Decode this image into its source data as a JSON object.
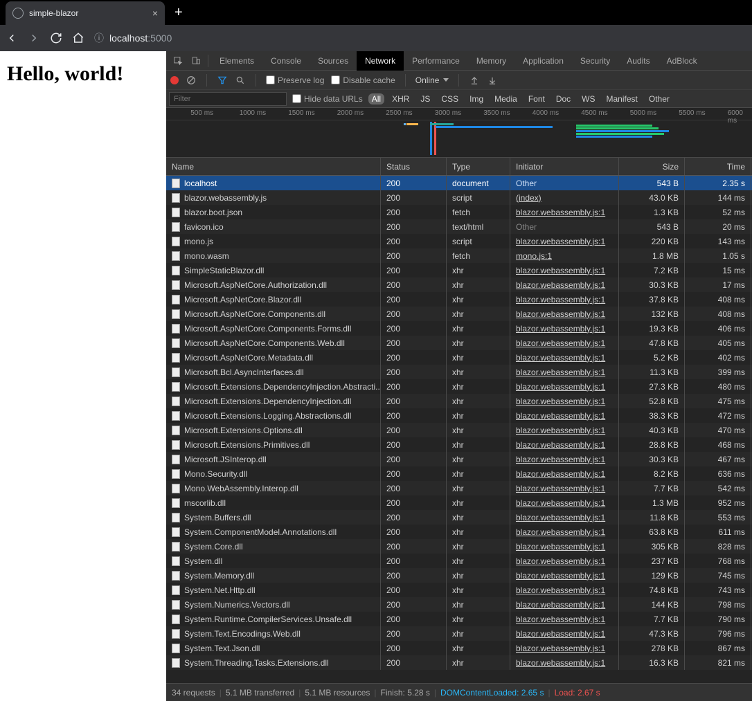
{
  "browser": {
    "tab_title": "simple-blazor",
    "url_info_icon": "ⓘ",
    "url_host": "localhost",
    "url_port": ":5000"
  },
  "page": {
    "heading": "Hello, world!"
  },
  "devtools": {
    "tabs": [
      "Elements",
      "Console",
      "Sources",
      "Network",
      "Performance",
      "Memory",
      "Application",
      "Security",
      "Audits",
      "AdBlock"
    ],
    "active_tab": "Network",
    "toolbar": {
      "preserve_log": "Preserve log",
      "disable_cache": "Disable cache",
      "online": "Online"
    },
    "filter": {
      "placeholder": "Filter",
      "hide_data_urls": "Hide data URLs",
      "chips": [
        "All",
        "XHR",
        "JS",
        "CSS",
        "Img",
        "Media",
        "Font",
        "Doc",
        "WS",
        "Manifest",
        "Other"
      ],
      "active_chip": "All"
    },
    "timeline_ticks": [
      "500 ms",
      "1000 ms",
      "1500 ms",
      "2000 ms",
      "2500 ms",
      "3000 ms",
      "3500 ms",
      "4000 ms",
      "4500 ms",
      "5000 ms",
      "5500 ms",
      "6000 ms"
    ],
    "columns": {
      "name": "Name",
      "status": "Status",
      "type": "Type",
      "initiator": "Initiator",
      "size": "Size",
      "time": "Time"
    },
    "rows": [
      {
        "name": "localhost",
        "status": "200",
        "type": "document",
        "initiator": "Other",
        "init_link": false,
        "size": "543 B",
        "time": "2.35 s",
        "selected": true
      },
      {
        "name": "blazor.webassembly.js",
        "status": "200",
        "type": "script",
        "initiator": "(index)",
        "init_link": true,
        "size": "43.0 KB",
        "time": "144 ms"
      },
      {
        "name": "blazor.boot.json",
        "status": "200",
        "type": "fetch",
        "initiator": "blazor.webassembly.js:1",
        "init_link": true,
        "size": "1.3 KB",
        "time": "52 ms"
      },
      {
        "name": "favicon.ico",
        "status": "200",
        "type": "text/html",
        "initiator": "Other",
        "init_link": false,
        "size": "543 B",
        "time": "20 ms"
      },
      {
        "name": "mono.js",
        "status": "200",
        "type": "script",
        "initiator": "blazor.webassembly.js:1",
        "init_link": true,
        "size": "220 KB",
        "time": "143 ms"
      },
      {
        "name": "mono.wasm",
        "status": "200",
        "type": "fetch",
        "initiator": "mono.js:1",
        "init_link": true,
        "size": "1.8 MB",
        "time": "1.05 s"
      },
      {
        "name": "SimpleStaticBlazor.dll",
        "status": "200",
        "type": "xhr",
        "initiator": "blazor.webassembly.js:1",
        "init_link": true,
        "size": "7.2 KB",
        "time": "15 ms"
      },
      {
        "name": "Microsoft.AspNetCore.Authorization.dll",
        "status": "200",
        "type": "xhr",
        "initiator": "blazor.webassembly.js:1",
        "init_link": true,
        "size": "30.3 KB",
        "time": "17 ms"
      },
      {
        "name": "Microsoft.AspNetCore.Blazor.dll",
        "status": "200",
        "type": "xhr",
        "initiator": "blazor.webassembly.js:1",
        "init_link": true,
        "size": "37.8 KB",
        "time": "408 ms"
      },
      {
        "name": "Microsoft.AspNetCore.Components.dll",
        "status": "200",
        "type": "xhr",
        "initiator": "blazor.webassembly.js:1",
        "init_link": true,
        "size": "132 KB",
        "time": "408 ms"
      },
      {
        "name": "Microsoft.AspNetCore.Components.Forms.dll",
        "status": "200",
        "type": "xhr",
        "initiator": "blazor.webassembly.js:1",
        "init_link": true,
        "size": "19.3 KB",
        "time": "406 ms"
      },
      {
        "name": "Microsoft.AspNetCore.Components.Web.dll",
        "status": "200",
        "type": "xhr",
        "initiator": "blazor.webassembly.js:1",
        "init_link": true,
        "size": "47.8 KB",
        "time": "405 ms"
      },
      {
        "name": "Microsoft.AspNetCore.Metadata.dll",
        "status": "200",
        "type": "xhr",
        "initiator": "blazor.webassembly.js:1",
        "init_link": true,
        "size": "5.2 KB",
        "time": "402 ms"
      },
      {
        "name": "Microsoft.Bcl.AsyncInterfaces.dll",
        "status": "200",
        "type": "xhr",
        "initiator": "blazor.webassembly.js:1",
        "init_link": true,
        "size": "11.3 KB",
        "time": "399 ms"
      },
      {
        "name": "Microsoft.Extensions.DependencyInjection.Abstracti...",
        "status": "200",
        "type": "xhr",
        "initiator": "blazor.webassembly.js:1",
        "init_link": true,
        "size": "27.3 KB",
        "time": "480 ms"
      },
      {
        "name": "Microsoft.Extensions.DependencyInjection.dll",
        "status": "200",
        "type": "xhr",
        "initiator": "blazor.webassembly.js:1",
        "init_link": true,
        "size": "52.8 KB",
        "time": "475 ms"
      },
      {
        "name": "Microsoft.Extensions.Logging.Abstractions.dll",
        "status": "200",
        "type": "xhr",
        "initiator": "blazor.webassembly.js:1",
        "init_link": true,
        "size": "38.3 KB",
        "time": "472 ms"
      },
      {
        "name": "Microsoft.Extensions.Options.dll",
        "status": "200",
        "type": "xhr",
        "initiator": "blazor.webassembly.js:1",
        "init_link": true,
        "size": "40.3 KB",
        "time": "470 ms"
      },
      {
        "name": "Microsoft.Extensions.Primitives.dll",
        "status": "200",
        "type": "xhr",
        "initiator": "blazor.webassembly.js:1",
        "init_link": true,
        "size": "28.8 KB",
        "time": "468 ms"
      },
      {
        "name": "Microsoft.JSInterop.dll",
        "status": "200",
        "type": "xhr",
        "initiator": "blazor.webassembly.js:1",
        "init_link": true,
        "size": "30.3 KB",
        "time": "467 ms"
      },
      {
        "name": "Mono.Security.dll",
        "status": "200",
        "type": "xhr",
        "initiator": "blazor.webassembly.js:1",
        "init_link": true,
        "size": "8.2 KB",
        "time": "636 ms"
      },
      {
        "name": "Mono.WebAssembly.Interop.dll",
        "status": "200",
        "type": "xhr",
        "initiator": "blazor.webassembly.js:1",
        "init_link": true,
        "size": "7.7 KB",
        "time": "542 ms"
      },
      {
        "name": "mscorlib.dll",
        "status": "200",
        "type": "xhr",
        "initiator": "blazor.webassembly.js:1",
        "init_link": true,
        "size": "1.3 MB",
        "time": "952 ms"
      },
      {
        "name": "System.Buffers.dll",
        "status": "200",
        "type": "xhr",
        "initiator": "blazor.webassembly.js:1",
        "init_link": true,
        "size": "11.8 KB",
        "time": "553 ms"
      },
      {
        "name": "System.ComponentModel.Annotations.dll",
        "status": "200",
        "type": "xhr",
        "initiator": "blazor.webassembly.js:1",
        "init_link": true,
        "size": "63.8 KB",
        "time": "611 ms"
      },
      {
        "name": "System.Core.dll",
        "status": "200",
        "type": "xhr",
        "initiator": "blazor.webassembly.js:1",
        "init_link": true,
        "size": "305 KB",
        "time": "828 ms"
      },
      {
        "name": "System.dll",
        "status": "200",
        "type": "xhr",
        "initiator": "blazor.webassembly.js:1",
        "init_link": true,
        "size": "237 KB",
        "time": "768 ms"
      },
      {
        "name": "System.Memory.dll",
        "status": "200",
        "type": "xhr",
        "initiator": "blazor.webassembly.js:1",
        "init_link": true,
        "size": "129 KB",
        "time": "745 ms"
      },
      {
        "name": "System.Net.Http.dll",
        "status": "200",
        "type": "xhr",
        "initiator": "blazor.webassembly.js:1",
        "init_link": true,
        "size": "74.8 KB",
        "time": "743 ms"
      },
      {
        "name": "System.Numerics.Vectors.dll",
        "status": "200",
        "type": "xhr",
        "initiator": "blazor.webassembly.js:1",
        "init_link": true,
        "size": "144 KB",
        "time": "798 ms"
      },
      {
        "name": "System.Runtime.CompilerServices.Unsafe.dll",
        "status": "200",
        "type": "xhr",
        "initiator": "blazor.webassembly.js:1",
        "init_link": true,
        "size": "7.7 KB",
        "time": "790 ms"
      },
      {
        "name": "System.Text.Encodings.Web.dll",
        "status": "200",
        "type": "xhr",
        "initiator": "blazor.webassembly.js:1",
        "init_link": true,
        "size": "47.3 KB",
        "time": "796 ms"
      },
      {
        "name": "System.Text.Json.dll",
        "status": "200",
        "type": "xhr",
        "initiator": "blazor.webassembly.js:1",
        "init_link": true,
        "size": "278 KB",
        "time": "867 ms"
      },
      {
        "name": "System.Threading.Tasks.Extensions.dll",
        "status": "200",
        "type": "xhr",
        "initiator": "blazor.webassembly.js:1",
        "init_link": true,
        "size": "16.3 KB",
        "time": "821 ms"
      }
    ],
    "status": {
      "requests": "34 requests",
      "transferred": "5.1 MB transferred",
      "resources": "5.1 MB resources",
      "finish": "Finish: 5.28 s",
      "dom": "DOMContentLoaded: 2.65 s",
      "load": "Load: 2.67 s"
    }
  }
}
